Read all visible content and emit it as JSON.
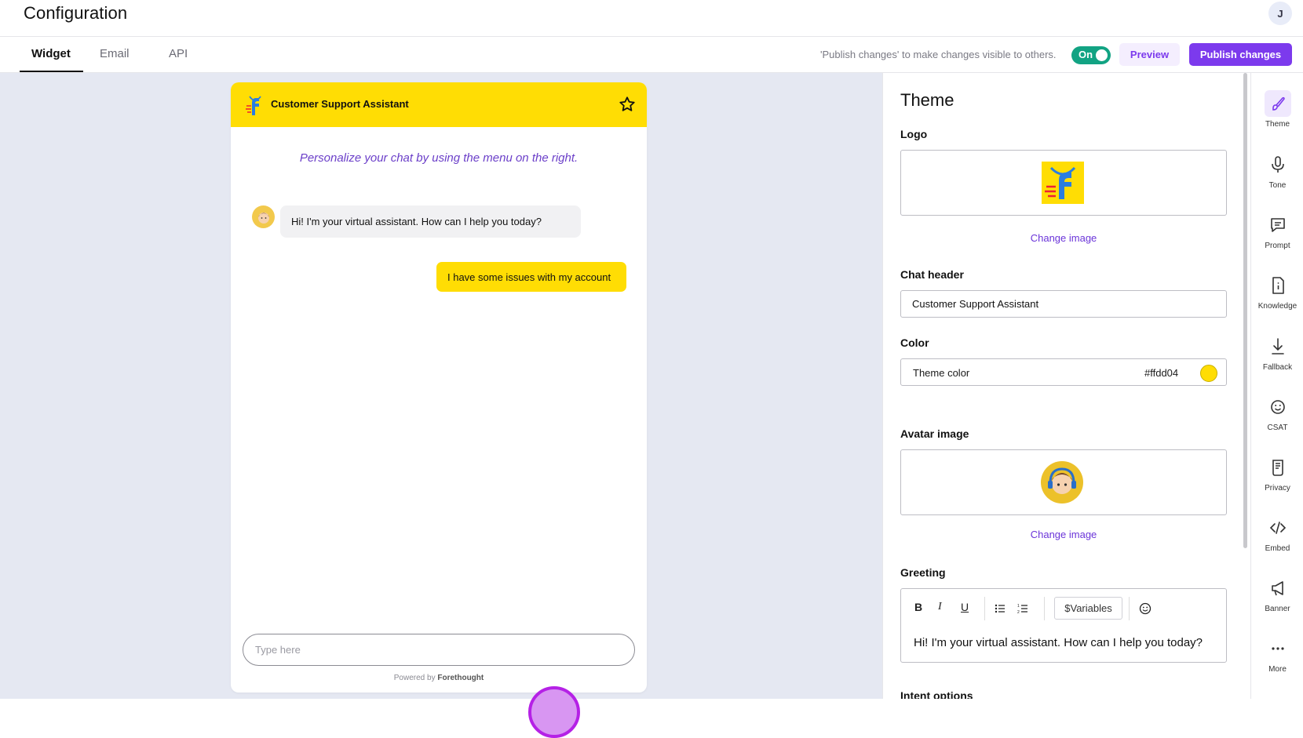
{
  "header": {
    "title": "Configuration",
    "user_initial": "J"
  },
  "tabs": [
    {
      "label": "Widget",
      "active": true
    },
    {
      "label": "Email",
      "active": false
    },
    {
      "label": "API",
      "active": false
    }
  ],
  "publish_bar": {
    "hint": "'Publish changes' to make changes visible to others.",
    "toggle_label": "On",
    "preview_label": "Preview",
    "publish_label": "Publish changes"
  },
  "chat_preview": {
    "title": "Customer Support Assistant",
    "hint": "Personalize your chat by using the menu on the right.",
    "bot_message": "Hi! I'm your virtual assistant. How can I help you today?",
    "user_message": "I have some issues with my account",
    "input_placeholder": "Type here",
    "powered_by": "Powered by",
    "brand": "Forethought",
    "theme_color": "#ffdd04"
  },
  "theme_panel": {
    "title": "Theme",
    "logo_label": "Logo",
    "change_image": "Change image",
    "chat_header_label": "Chat header",
    "chat_header_value": "Customer Support Assistant",
    "color_label": "Color",
    "color_field_label": "Theme color",
    "color_value": "#ffdd04",
    "avatar_label": "Avatar image",
    "greeting_label": "Greeting",
    "variables_label": "$Variables",
    "greeting_text": "Hi! I'm your virtual assistant. How can I help you today?",
    "intent_label": "Intent options"
  },
  "rail": [
    {
      "label": "Theme",
      "icon": "brush-icon",
      "active": true
    },
    {
      "label": "Tone",
      "icon": "microphone-icon"
    },
    {
      "label": "Prompt",
      "icon": "message-icon"
    },
    {
      "label": "Knowledge",
      "icon": "document-info-icon"
    },
    {
      "label": "Fallback",
      "icon": "download-arrow-icon"
    },
    {
      "label": "CSAT",
      "icon": "smiley-icon"
    },
    {
      "label": "Privacy",
      "icon": "receipt-icon"
    },
    {
      "label": "Embed",
      "icon": "code-icon"
    },
    {
      "label": "Banner",
      "icon": "megaphone-icon"
    },
    {
      "label": "More",
      "icon": "more-dots-icon"
    }
  ],
  "colors": {
    "accent": "#7c3aed",
    "toggle_on": "#12a383",
    "canvas": "#e5e8f2"
  }
}
